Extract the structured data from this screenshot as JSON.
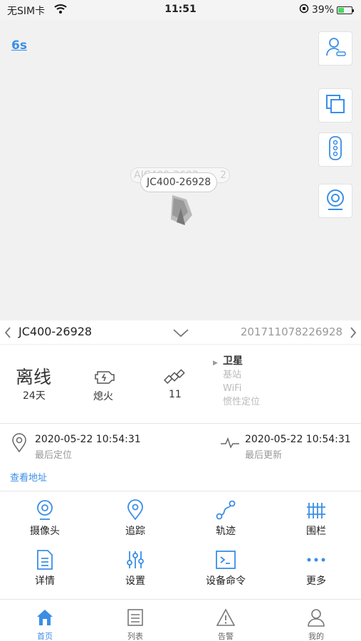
{
  "status_bar": {
    "carrier": "无SIM卡",
    "time": "11:51",
    "battery": "39%"
  },
  "map": {
    "refresh_countdown": "6s",
    "ghost_label": "AJC400-2692",
    "ghost_suffix": "2",
    "device_label": "JC400-26928"
  },
  "device": {
    "name": "JC400-26928",
    "imei": "201711078226928"
  },
  "status": {
    "state": "离线",
    "duration": "24天",
    "ignition": "熄火",
    "satellites": "11",
    "modes": [
      "卫星",
      "基站",
      "WiFi",
      "惯性定位"
    ],
    "active_mode": "卫星"
  },
  "times": {
    "last_location_time": "2020-05-22 10:54:31",
    "last_location_label": "最后定位",
    "last_update_time": "2020-05-22 10:54:31",
    "last_update_label": "最后更新",
    "view_address": "查看地址"
  },
  "actions": [
    {
      "label": "摄像头",
      "icon": "camera-icon"
    },
    {
      "label": "追踪",
      "icon": "location-pin-icon"
    },
    {
      "label": "轨迹",
      "icon": "track-icon"
    },
    {
      "label": "围栏",
      "icon": "fence-icon"
    },
    {
      "label": "详情",
      "icon": "document-icon"
    },
    {
      "label": "设置",
      "icon": "sliders-icon"
    },
    {
      "label": "设备命令",
      "icon": "terminal-icon"
    },
    {
      "label": "更多",
      "icon": "more-icon"
    }
  ],
  "tabs": [
    {
      "label": "首页",
      "icon": "home-icon",
      "active": true
    },
    {
      "label": "列表",
      "icon": "list-icon",
      "active": false
    },
    {
      "label": "告警",
      "icon": "warning-icon",
      "active": false
    },
    {
      "label": "我的",
      "icon": "user-icon",
      "active": false
    }
  ],
  "colors": {
    "accent": "#3a8ee6",
    "muted": "#999999"
  }
}
